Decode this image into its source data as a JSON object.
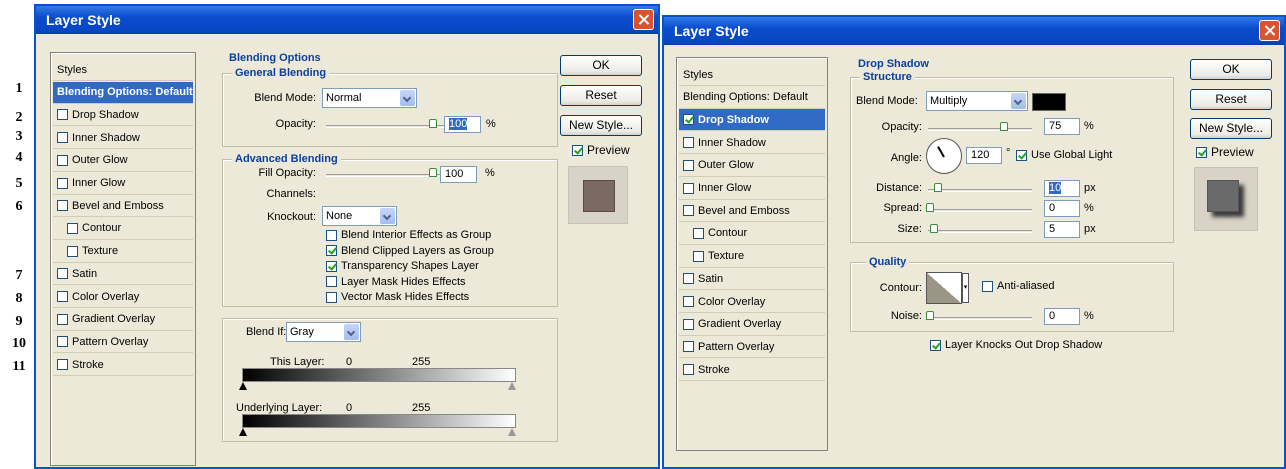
{
  "row_numbers": [
    "1",
    "2",
    "3",
    "4",
    "5",
    "6",
    "7",
    "8",
    "9",
    "10",
    "11"
  ],
  "left": {
    "title": "Layer Style",
    "styles": [
      {
        "label": "Styles",
        "checkbox": false,
        "selected": false,
        "indent": false
      },
      {
        "label": "Blending Options: Default",
        "checkbox": false,
        "selected": true,
        "indent": false
      },
      {
        "label": "Drop Shadow",
        "checkbox": true,
        "checked": false,
        "indent": false
      },
      {
        "label": "Inner Shadow",
        "checkbox": true,
        "checked": false,
        "indent": false
      },
      {
        "label": "Outer Glow",
        "checkbox": true,
        "checked": false,
        "indent": false
      },
      {
        "label": "Inner Glow",
        "checkbox": true,
        "checked": false,
        "indent": false
      },
      {
        "label": "Bevel and Emboss",
        "checkbox": true,
        "checked": false,
        "indent": false
      },
      {
        "label": "Contour",
        "checkbox": true,
        "checked": false,
        "indent": true
      },
      {
        "label": "Texture",
        "checkbox": true,
        "checked": false,
        "indent": true
      },
      {
        "label": "Satin",
        "checkbox": true,
        "checked": false,
        "indent": false
      },
      {
        "label": "Color Overlay",
        "checkbox": true,
        "checked": false,
        "indent": false
      },
      {
        "label": "Gradient Overlay",
        "checkbox": true,
        "checked": false,
        "indent": false
      },
      {
        "label": "Pattern Overlay",
        "checkbox": true,
        "checked": false,
        "indent": false
      },
      {
        "label": "Stroke",
        "checkbox": true,
        "checked": false,
        "indent": false
      }
    ],
    "blending_options": {
      "title": "Blending Options",
      "general": "General Blending",
      "blend_mode_label": "Blend Mode:",
      "blend_mode": "Normal",
      "opacity_label": "Opacity:",
      "opacity": "100",
      "pct": "%",
      "advanced": "Advanced Blending",
      "fill_opacity_label": "Fill Opacity:",
      "fill_opacity": "100",
      "channels_label": "Channels:",
      "knockout_label": "Knockout:",
      "knockout": "None",
      "checks": [
        {
          "label": "Blend Interior Effects as Group",
          "checked": false
        },
        {
          "label": "Blend Clipped Layers as Group",
          "checked": true
        },
        {
          "label": "Transparency Shapes Layer",
          "checked": true
        },
        {
          "label": "Layer Mask Hides Effects",
          "checked": false
        },
        {
          "label": "Vector Mask Hides Effects",
          "checked": false
        }
      ],
      "blend_if_label": "Blend If:",
      "blend_if": "Gray",
      "this_layer_label": "This Layer:",
      "this_layer_min": "0",
      "this_layer_max": "255",
      "underlying_label": "Underlying Layer:",
      "underlying_min": "0",
      "underlying_max": "255"
    },
    "buttons": {
      "ok": "OK",
      "reset": "Reset",
      "new_style": "New Style...",
      "preview": "Preview"
    },
    "preview_swatch_color": "#7b6a62"
  },
  "right": {
    "title": "Layer Style",
    "styles": [
      {
        "label": "Styles",
        "checkbox": false,
        "selected": false,
        "indent": false
      },
      {
        "label": "Blending Options: Default",
        "checkbox": false,
        "selected": false,
        "indent": false
      },
      {
        "label": "Drop Shadow",
        "checkbox": true,
        "checked": true,
        "selected": true,
        "indent": false
      },
      {
        "label": "Inner Shadow",
        "checkbox": true,
        "checked": false,
        "indent": false
      },
      {
        "label": "Outer Glow",
        "checkbox": true,
        "checked": false,
        "indent": false
      },
      {
        "label": "Inner Glow",
        "checkbox": true,
        "checked": false,
        "indent": false
      },
      {
        "label": "Bevel and Emboss",
        "checkbox": true,
        "checked": false,
        "indent": false
      },
      {
        "label": "Contour",
        "checkbox": true,
        "checked": false,
        "indent": true
      },
      {
        "label": "Texture",
        "checkbox": true,
        "checked": false,
        "indent": true
      },
      {
        "label": "Satin",
        "checkbox": true,
        "checked": false,
        "indent": false
      },
      {
        "label": "Color Overlay",
        "checkbox": true,
        "checked": false,
        "indent": false
      },
      {
        "label": "Gradient Overlay",
        "checkbox": true,
        "checked": false,
        "indent": false
      },
      {
        "label": "Pattern Overlay",
        "checkbox": true,
        "checked": false,
        "indent": false
      },
      {
        "label": "Stroke",
        "checkbox": true,
        "checked": false,
        "indent": false
      }
    ],
    "drop_shadow": {
      "title": "Drop Shadow",
      "structure": "Structure",
      "blend_mode_label": "Blend Mode:",
      "blend_mode": "Multiply",
      "shadow_color": "#000000",
      "opacity_label": "Opacity:",
      "opacity": "75",
      "angle_label": "Angle:",
      "angle": "120",
      "deg": "°",
      "global_light_label": "Use Global Light",
      "global_light": true,
      "distance_label": "Distance:",
      "distance": "10",
      "spread_label": "Spread:",
      "spread": "0",
      "size_label": "Size:",
      "size": "5",
      "px": "px",
      "pct": "%",
      "quality": "Quality",
      "contour_label": "Contour:",
      "antialiased_label": "Anti-aliased",
      "noise_label": "Noise:",
      "noise": "0",
      "knockout_label": "Layer Knocks Out Drop Shadow"
    },
    "buttons": {
      "ok": "OK",
      "reset": "Reset",
      "new_style": "New Style...",
      "preview": "Preview"
    }
  }
}
